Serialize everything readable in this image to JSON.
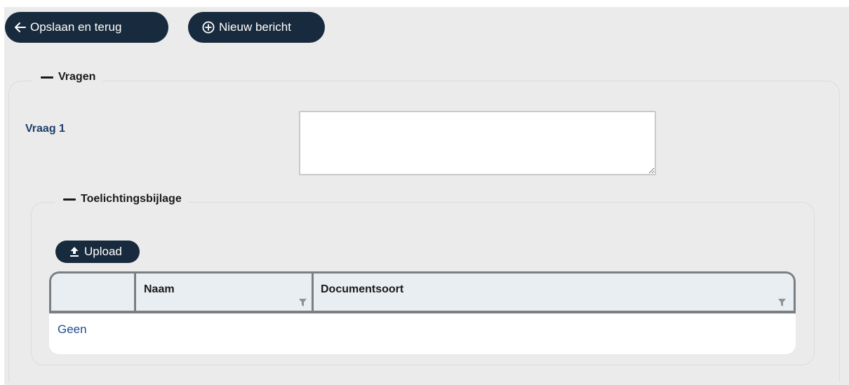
{
  "toolbar": {
    "back_label": "Opslaan en terug",
    "new_message_label": "Nieuw bericht"
  },
  "section_vragen": {
    "legend": "Vragen",
    "question_label": "Vraag 1",
    "question_value": ""
  },
  "section_bijlage": {
    "legend": "Toelichtingsbijlage",
    "upload_label": "Upload",
    "grid": {
      "columns": [
        "",
        "Naam",
        "Documentsoort"
      ],
      "empty_text": "Geen"
    }
  },
  "colors": {
    "button_bg": "#182a3d",
    "page_bg": "#ebebeb",
    "label_blue": "#1f3f6b",
    "link_blue": "#1f4e8c"
  }
}
